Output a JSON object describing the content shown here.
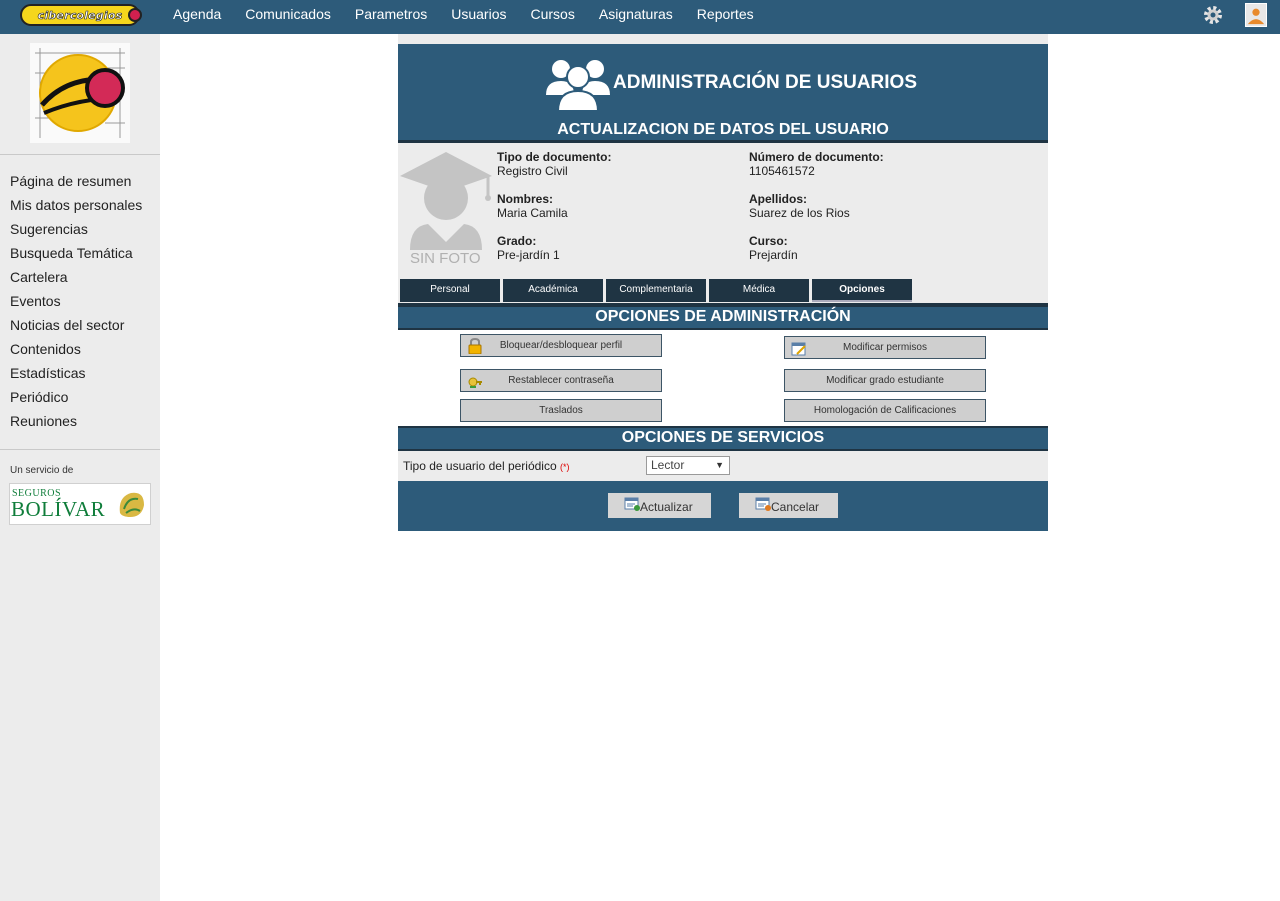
{
  "app": {
    "logo_text": "cibercolegios"
  },
  "topnav": {
    "items": [
      "Agenda",
      "Comunicados",
      "Parametros",
      "Usuarios",
      "Cursos",
      "Asignaturas",
      "Reportes"
    ],
    "settings_icon": "gear-icon",
    "user_icon": "user-avatar-icon"
  },
  "sidebar": {
    "items": [
      "Página de resumen",
      "Mis datos personales",
      "Sugerencias",
      "Busqueda Temática",
      "Cartelera",
      "Eventos",
      "Noticias del sector",
      "Contenidos",
      "Estadísticas",
      "Periódico",
      "Reuniones"
    ],
    "service_label": "Un servicio de",
    "sponsor": {
      "line1": "SEGUROS",
      "line2": "BOLÍVAR"
    }
  },
  "header": {
    "title": "ADMINISTRACIÓN DE USUARIOS",
    "subtitle": "ACTUALIZACION DE DATOS DEL USUARIO"
  },
  "profile": {
    "photo_text": "SIN FOTO",
    "tipo_documento_label": "Tipo de documento:",
    "tipo_documento_value": "Registro Civil",
    "numero_documento_label": "Número de documento:",
    "numero_documento_value": "1105461572",
    "nombres_label": "Nombres:",
    "nombres_value": "Maria Camila",
    "apellidos_label": "Apellidos:",
    "apellidos_value": "Suarez de los Rios",
    "grado_label": "Grado:",
    "grado_value": "Pre-jardín 1",
    "curso_label": "Curso:",
    "curso_value": "Prejardín"
  },
  "tabs": {
    "items": [
      "Personal",
      "Académica",
      "Complementaria",
      "Médica",
      "Opciones"
    ],
    "active": "Opciones"
  },
  "admin_options": {
    "title": "OPCIONES DE ADMINISTRACIÓN",
    "buttons": {
      "bloquear": "Bloquear/desbloquear perfil",
      "permisos": "Modificar permisos",
      "restablecer": "Restablecer contraseña",
      "grado": "Modificar grado estudiante",
      "traslados": "Traslados",
      "homologacion": "Homologación de Calificaciones"
    }
  },
  "service_options": {
    "title": "OPCIONES DE SERVICIOS",
    "periodico_label": "Tipo de usuario del periódico",
    "required_mark": "(*)",
    "periodico_value": "Lector"
  },
  "actions": {
    "update": "Actualizar",
    "cancel": "Cancelar"
  },
  "colors": {
    "topbar": "#2d5b7a",
    "dark": "#1f3443",
    "sidebar_bg": "#ececec"
  }
}
